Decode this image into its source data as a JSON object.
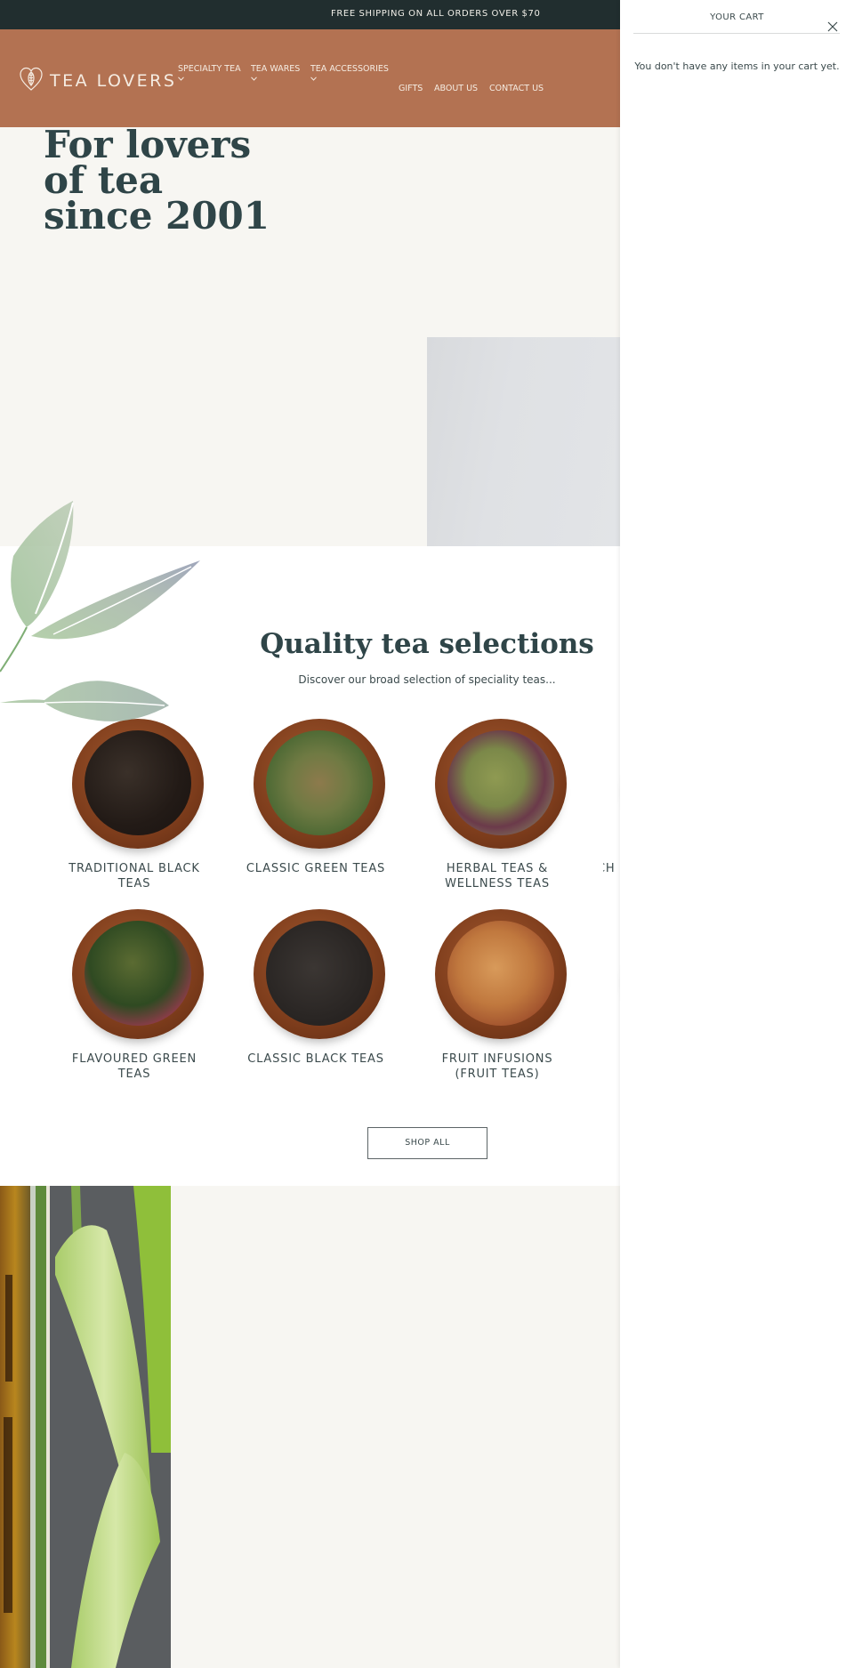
{
  "announcement": "FREE SHIPPING ON ALL ORDERS OVER $70",
  "header": {
    "logo_text": "TEA LOVERS",
    "logo_icon": "heart-leaf-icon",
    "nav_primary": [
      {
        "label": "SPECIALTY TEA",
        "has_dropdown": true
      },
      {
        "label": "TEA WARES",
        "has_dropdown": true
      },
      {
        "label": "TEA ACCESSORIES",
        "has_dropdown": true
      }
    ],
    "nav_secondary": [
      {
        "label": "GIFTS"
      },
      {
        "label": "ABOUT US"
      },
      {
        "label": "CONTACT US"
      }
    ]
  },
  "hero": {
    "title": "For lovers of tea since 2001"
  },
  "selections": {
    "title": "Quality tea selections",
    "subtitle": "Discover our broad selection of speciality teas...",
    "categories": [
      {
        "label": "TRADITIONAL BLACK TEAS",
        "image": "black-tea-bowl"
      },
      {
        "label": "CLASSIC GREEN TEAS",
        "image": "genmaicha-bowl"
      },
      {
        "label": "HERBAL TEAS & WELLNESS TEAS",
        "image": "herbal-tea-bowl"
      },
      {
        "label": "CH",
        "image": "partial-bowl"
      },
      {
        "label": "FLAVOURED GREEN TEAS",
        "image": "flavoured-green-bowl"
      },
      {
        "label": "CLASSIC BLACK TEAS",
        "image": "classic-black-bowl"
      },
      {
        "label": "FRUIT INFUSIONS (FRUIT TEAS)",
        "image": "fruit-infusion-bowl"
      },
      {
        "label": "",
        "image": "partial-bowl"
      }
    ],
    "shop_all_label": "SHOP ALL"
  },
  "cart": {
    "title": "YOUR CART",
    "empty_message": "You don't have any items in your cart yet.",
    "close_icon": "close-icon"
  },
  "colors": {
    "announcement_bg": "#212e2f",
    "header_bg": "#b37252",
    "hero_bg": "#f7f6f2",
    "heading_text": "#2f4548"
  }
}
